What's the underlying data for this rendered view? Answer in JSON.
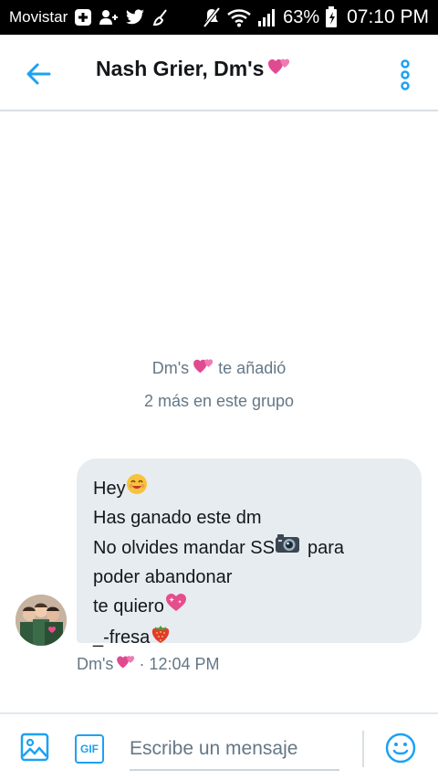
{
  "status_bar": {
    "carrier": "Movistar",
    "battery": "63%",
    "time": "07:10 PM",
    "icons": [
      "plus-box-icon",
      "add-person-icon",
      "twitter-bird-icon",
      "broom-icon",
      "mute-icon",
      "wifi-icon",
      "signal-icon",
      "battery-icon"
    ]
  },
  "header": {
    "title": "Nash Grier, Dm's",
    "title_emoji": "two-hearts-icon",
    "accent": "#1da1f2"
  },
  "system_messages": {
    "added_prefix": "Dm's",
    "added_suffix": "te añadió",
    "more": "2 más en este grupo"
  },
  "message": {
    "lines": [
      "Hey",
      "Has ganado este dm",
      "No olvides mandar SS",
      "para",
      "poder abandonar",
      "te quiero",
      "_-fresa"
    ],
    "sender": "Dm's",
    "time": "· 12:04 PM",
    "bubble_color": "#e6ecf0"
  },
  "composer": {
    "placeholder": "Escribe un mensaje",
    "gif_label": "GIF"
  }
}
